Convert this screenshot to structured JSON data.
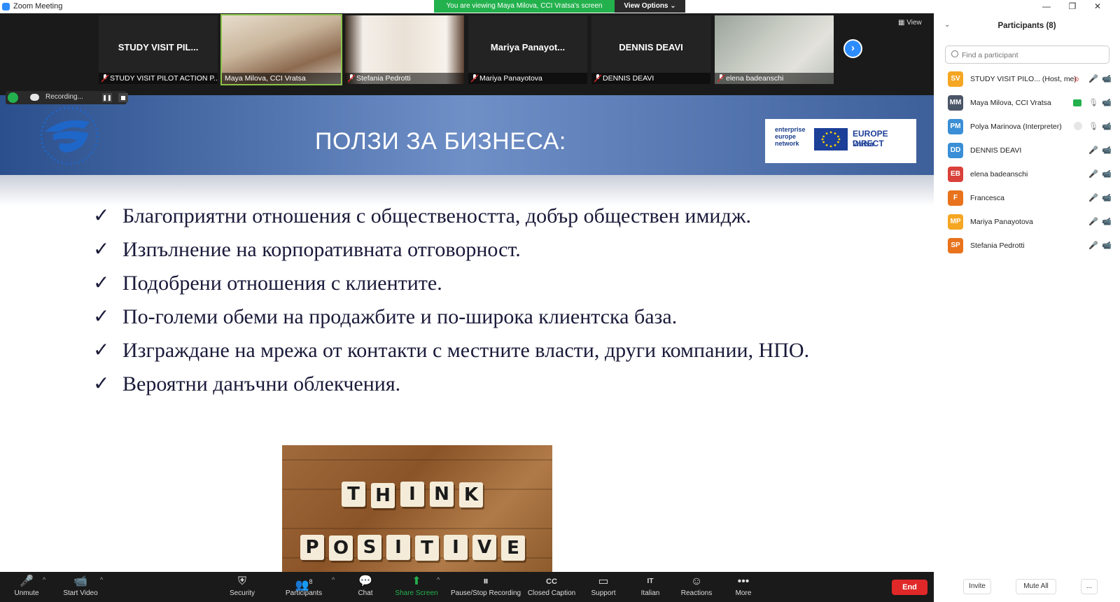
{
  "window": {
    "title": "Zoom Meeting",
    "minimize_icon": "—",
    "restore_icon": "❐",
    "close_icon": "✕"
  },
  "banner": {
    "viewing_text": "You are viewing Maya Milova, CCI Vratsa's screen",
    "view_options_label": "View Options ⌄"
  },
  "video_strip": {
    "view_label": "View",
    "tiles": [
      {
        "name": "STUDY VISIT PIL...",
        "label": "STUDY VISIT PILOT ACTION P..."
      },
      {
        "name": "",
        "label": "Maya Milova, CCI Vratsa"
      },
      {
        "name": "",
        "label": "Stefania Pedrotti"
      },
      {
        "name": "Mariya  Panayot...",
        "label": "Mariya Panayotova"
      },
      {
        "name": "DENNIS DEAVI",
        "label": "DENNIS DEAVI"
      },
      {
        "name": "",
        "label": "elena badeanschi"
      }
    ]
  },
  "recording": {
    "label": "Recording...",
    "pause_icon": "❚❚"
  },
  "slide": {
    "title": "ПОЛЗИ ЗА БИЗНЕСА:",
    "logo_box": {
      "een_line1": "enterprise",
      "een_line2": "europe",
      "een_line3": "network",
      "direct_label": "EUROPE DIRECT",
      "city": "Vratsa"
    },
    "check": "✓",
    "bullets": [
      "Благоприятни отношения с обществеността, добър обществен имидж.",
      "Изпълнение на корпоративната отговорност.",
      "Подобрени отношения с клиентите.",
      "По-големи обеми на продажбите и по-широка клиентска база.",
      "Изграждане на мрежа от контакти с местните власти, други компании, НПО.",
      "Вероятни данъчни облекчения."
    ],
    "tiles_row1": [
      "T",
      "H",
      "I",
      "N",
      "K"
    ],
    "tiles_row2": [
      "P",
      "O",
      "S",
      "I",
      "T",
      "I",
      "V",
      "E"
    ]
  },
  "toolbar": {
    "items": [
      {
        "icon": "🎤",
        "label": "Unmute"
      },
      {
        "icon": "📹",
        "label": "Start Video"
      },
      {
        "icon": "⛨",
        "label": "Security"
      },
      {
        "icon": "👥",
        "label": "Participants",
        "count": "8"
      },
      {
        "icon": "💬",
        "label": "Chat"
      },
      {
        "icon": "⬆",
        "label": "Share Screen"
      },
      {
        "icon": "⏸",
        "label": "Pause/Stop Recording"
      },
      {
        "icon": "CC",
        "label": "Closed Caption"
      },
      {
        "icon": "▭",
        "label": "Support"
      },
      {
        "icon": "IT",
        "label": "Italian"
      },
      {
        "icon": "☺",
        "label": "Reactions"
      },
      {
        "icon": "•••",
        "label": "More"
      }
    ],
    "caret": "^",
    "end_label": "End"
  },
  "participants_panel": {
    "title": "Participants (8)",
    "collapse_icon": "⌄",
    "search_placeholder": "Find a participant",
    "participants": [
      {
        "initials": "SV",
        "name": "STUDY VISIT PILO... (Host, me)",
        "color": "#f5a623"
      },
      {
        "initials": "MM",
        "name": "Maya Milova, CCI Vratsa",
        "color": "#4a5568"
      },
      {
        "initials": "PM",
        "name": "Polya Marinova (Interpreter)",
        "color": "#3a8fd6"
      },
      {
        "initials": "DD",
        "name": "DENNIS DEAVI",
        "color": "#3a8fd6"
      },
      {
        "initials": "EB",
        "name": "elena badeanschi",
        "color": "#d9413a"
      },
      {
        "initials": "F",
        "name": "Francesca",
        "color": "#e8731c"
      },
      {
        "initials": "MP",
        "name": "Mariya Panayotova",
        "color": "#f5a623"
      },
      {
        "initials": "SP",
        "name": "Stefania Pedrotti",
        "color": "#e8731c"
      }
    ],
    "invite_label": "Invite",
    "mute_all_label": "Mute All",
    "more_label": "..."
  }
}
